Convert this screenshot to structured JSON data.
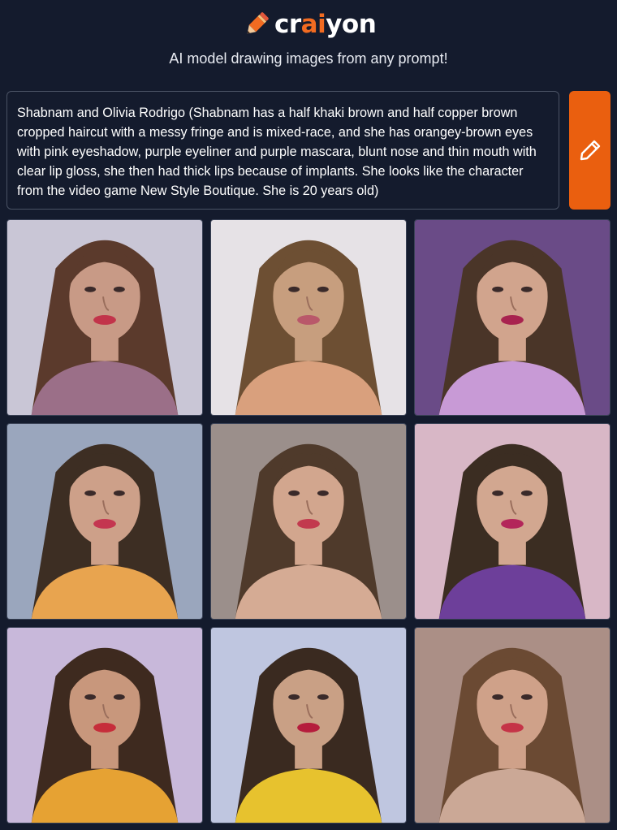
{
  "app": {
    "logo_prefix": "cr",
    "logo_ai": "ai",
    "logo_suffix": "yon",
    "tagline": "AI model drawing images from any prompt!",
    "accent_color": "#f26b21",
    "background_color": "#141b2d"
  },
  "prompt": {
    "text": "Shabnam  and Olivia Rodrigo (Shabnam has a half khaki brown and half copper brown cropped haircut with a messy fringe and is mixed-race, and she has orangey-brown eyes with pink eyeshadow, purple eyeliner and purple mascara, blunt nose and thin mouth with clear lip gloss, she then had thick lips because of implants. She looks like the character from the video game New Style Boutique. She is 20 years old)"
  },
  "draw_button": {
    "icon": "pencil-icon"
  },
  "images": [
    {
      "bg": "#c9c6d6",
      "hair": "#5b3a2c",
      "skin": "#c89a86",
      "top": "#9b6f88",
      "lips": "#c2344a"
    },
    {
      "bg": "#e6e2e6",
      "hair": "#6d4f33",
      "skin": "#c79e7e",
      "top": "#d9a07d",
      "lips": "#b9586a"
    },
    {
      "bg": "#6a4b87",
      "hair": "#4a3528",
      "skin": "#d1a48d",
      "top": "#c89ad6",
      "lips": "#a8234f"
    },
    {
      "bg": "#9aa6bd",
      "hair": "#3d2e23",
      "skin": "#cda089",
      "top": "#e8a44f",
      "lips": "#c43650"
    },
    {
      "bg": "#9b8f8b",
      "hair": "#4f3a2b",
      "skin": "#d2a68e",
      "top": "#d5ab94",
      "lips": "#c23a4e"
    },
    {
      "bg": "#d8b7c6",
      "hair": "#3b2d22",
      "skin": "#d2a790",
      "top": "#6d3f9a",
      "lips": "#b3265a"
    },
    {
      "bg": "#c8b8da",
      "hair": "#3e2a1f",
      "skin": "#c8977c",
      "top": "#e6a233",
      "lips": "#c62d3a"
    },
    {
      "bg": "#bfc6e0",
      "hair": "#3a2a20",
      "skin": "#c9a085",
      "top": "#e7c22e",
      "lips": "#b51d3c"
    },
    {
      "bg": "#ab8f86",
      "hair": "#6b4a33",
      "skin": "#cfa189",
      "top": "#cba896",
      "lips": "#c53447"
    }
  ]
}
